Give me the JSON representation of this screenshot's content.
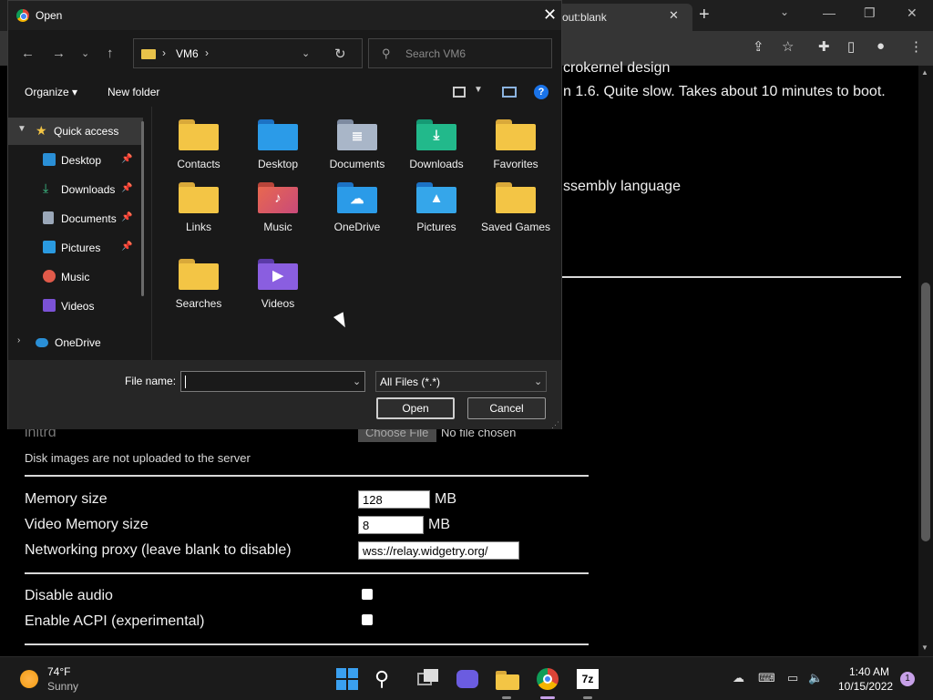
{
  "browser": {
    "tab_title": "out:blank",
    "tab_close": "✕",
    "new_tab": "+",
    "content_lines": {
      "line1": "crokernel design",
      "line2": "n 1.6. Quite slow. Takes about 10 minutes to boot.",
      "line3": "ssembly language"
    },
    "initrd_label": "initrd",
    "choose_file": "Choose File",
    "no_file": "No file chosen",
    "disk_note": "Disk images are not uploaded to the server",
    "memory_label": "Memory size",
    "memory_value": "128",
    "memory_unit": "MB",
    "vmem_label": "Video Memory size",
    "vmem_value": "8",
    "vmem_unit": "MB",
    "proxy_label": "Networking proxy (leave blank to disable)",
    "proxy_value": "wss://relay.widgetry.org/",
    "audio_label": "Disable audio",
    "acpi_label": "Enable ACPI (experimental)"
  },
  "dialog": {
    "title": "Open",
    "address_path": "VM6",
    "search_placeholder": "Search VM6",
    "organize": "Organize ▾",
    "new_folder": "New folder",
    "help": "?",
    "nav_items": [
      {
        "label": "Quick access"
      },
      {
        "label": "Desktop"
      },
      {
        "label": "Downloads"
      },
      {
        "label": "Documents"
      },
      {
        "label": "Pictures"
      },
      {
        "label": "Music"
      },
      {
        "label": "Videos"
      },
      {
        "label": "OneDrive"
      }
    ],
    "files": [
      {
        "label": "Contacts"
      },
      {
        "label": "Desktop"
      },
      {
        "label": "Documents"
      },
      {
        "label": "Downloads"
      },
      {
        "label": "Favorites"
      },
      {
        "label": "Links"
      },
      {
        "label": "Music"
      },
      {
        "label": "OneDrive"
      },
      {
        "label": "Pictures"
      },
      {
        "label": "Saved Games"
      },
      {
        "label": "Searches"
      },
      {
        "label": "Videos"
      }
    ],
    "file_name_label": "File name:",
    "file_name_value": "",
    "filter_value": "All Files (*.*)",
    "open_label": "Open",
    "cancel_label": "Cancel"
  },
  "taskbar": {
    "temp": "74°F",
    "condition": "Sunny",
    "time": "1:40 AM",
    "date": "10/15/2022",
    "notifications": "1"
  },
  "colors": {
    "folder_yellow": "#f3c545",
    "dialog_bg": "#191919",
    "accent_blue": "#1a73e8"
  }
}
